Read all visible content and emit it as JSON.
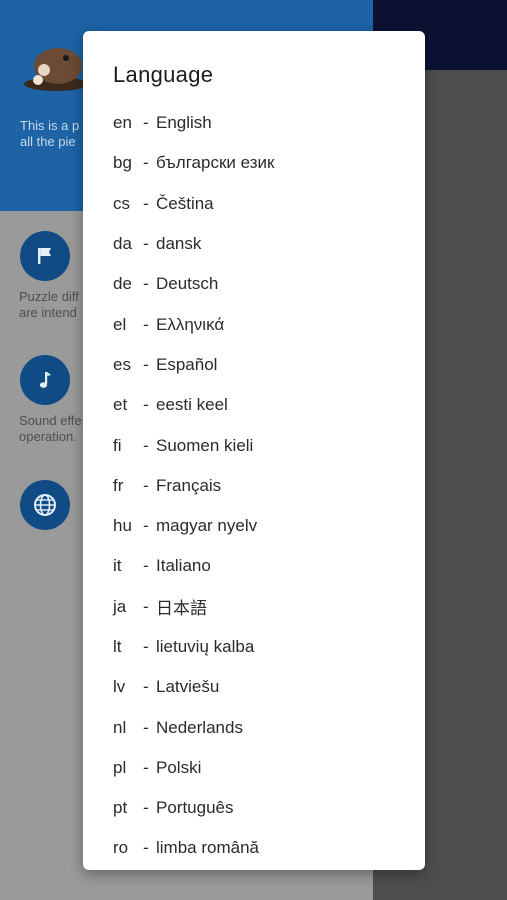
{
  "background": {
    "header_text": "This is a p\nall the pie",
    "items": [
      {
        "icon": "flag-icon",
        "text": "Puzzle diff\nare intend"
      },
      {
        "icon": "music-note-icon",
        "text": "Sound effe\noperation."
      },
      {
        "icon": "globe-icon",
        "text": ""
      }
    ]
  },
  "dialog": {
    "title": "Language",
    "separator": "-",
    "languages": [
      {
        "code": "en",
        "name": "English"
      },
      {
        "code": "bg",
        "name": "български език"
      },
      {
        "code": "cs",
        "name": "Čeština"
      },
      {
        "code": "da",
        "name": "dansk"
      },
      {
        "code": "de",
        "name": "Deutsch"
      },
      {
        "code": "el",
        "name": "Ελληνικά"
      },
      {
        "code": "es",
        "name": "Español"
      },
      {
        "code": "et",
        "name": "eesti keel"
      },
      {
        "code": "fi",
        "name": "Suomen kieli"
      },
      {
        "code": "fr",
        "name": "Français"
      },
      {
        "code": "hu",
        "name": "magyar nyelv"
      },
      {
        "code": "it",
        "name": "Italiano"
      },
      {
        "code": "ja",
        "name": "日本語"
      },
      {
        "code": "lt",
        "name": "lietuvių kalba"
      },
      {
        "code": "lv",
        "name": "Latviešu"
      },
      {
        "code": "nl",
        "name": "Nederlands"
      },
      {
        "code": "pl",
        "name": "Polski"
      },
      {
        "code": "pt",
        "name": "Português"
      },
      {
        "code": "ro",
        "name": "limba română"
      }
    ]
  },
  "colors": {
    "header_blue": "#1e63a6",
    "circle_blue": "#114b86",
    "dialog_bg": "#ffffff",
    "text": "#2b2b2b"
  }
}
